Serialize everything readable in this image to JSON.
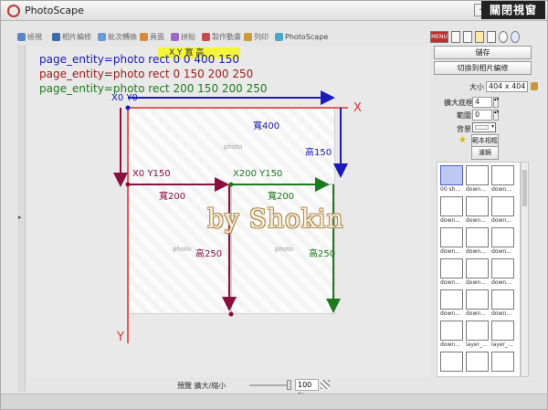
{
  "window": {
    "title": "PhotoScape",
    "tray_label": "關閉視窗"
  },
  "tabs": [
    {
      "label": "檢視"
    },
    {
      "label": "相片編修"
    },
    {
      "label": "批次轉換"
    },
    {
      "label": "頁面"
    },
    {
      "label": "拼貼"
    },
    {
      "label": "製作動畫"
    },
    {
      "label": "列印"
    },
    {
      "label": "PhotoScape"
    }
  ],
  "toolbar": {
    "menu_label": "MENU"
  },
  "annotations": {
    "xy_header": "X  Y   寬     高",
    "code_lines": [
      "page_entity=photo rect 0 0 400 150",
      "page_entity=photo rect 0 150 200 250",
      "page_entity=photo rect 200 150 200 250"
    ],
    "origin_label": "X0 Y0",
    "x_axis_label": "X",
    "y_axis_label": "Y",
    "width1": "寬400",
    "height1": "高150",
    "origin2": "X0 Y150",
    "origin3": "X200 Y150",
    "width2": "寬200",
    "width3": "寬200",
    "height2": "高250",
    "height3": "高250",
    "watermark": "by Shokin",
    "photo_placeholder": "photo"
  },
  "status": {
    "preview_label": "預覽 擴大/縮小",
    "zoom": "100 %"
  },
  "right_panel": {
    "save_label": "儲存",
    "switch_label": "切換到相片編修",
    "size_label": "大小",
    "size_value": "404 x 404",
    "border_label": "擴大底框",
    "border_value": "4",
    "range_label": "範圍",
    "range_value": "0",
    "bg_label": "背景",
    "template_label": "範本相框",
    "filter_label": "濾鏡"
  },
  "templates": [
    "00 sh...",
    "down...",
    "down...",
    "down...",
    "down...",
    "down...",
    "down...",
    "down...",
    "down...",
    "down...",
    "down...",
    "down...",
    "down...",
    "down...",
    "down...",
    "down...",
    "layer_...",
    "layer_..."
  ],
  "colors": {
    "blue": "#1a1ab8",
    "red": "#9c1818",
    "green": "#1e7a1e",
    "axis": "#e03030",
    "selected": "#bccaf2"
  }
}
